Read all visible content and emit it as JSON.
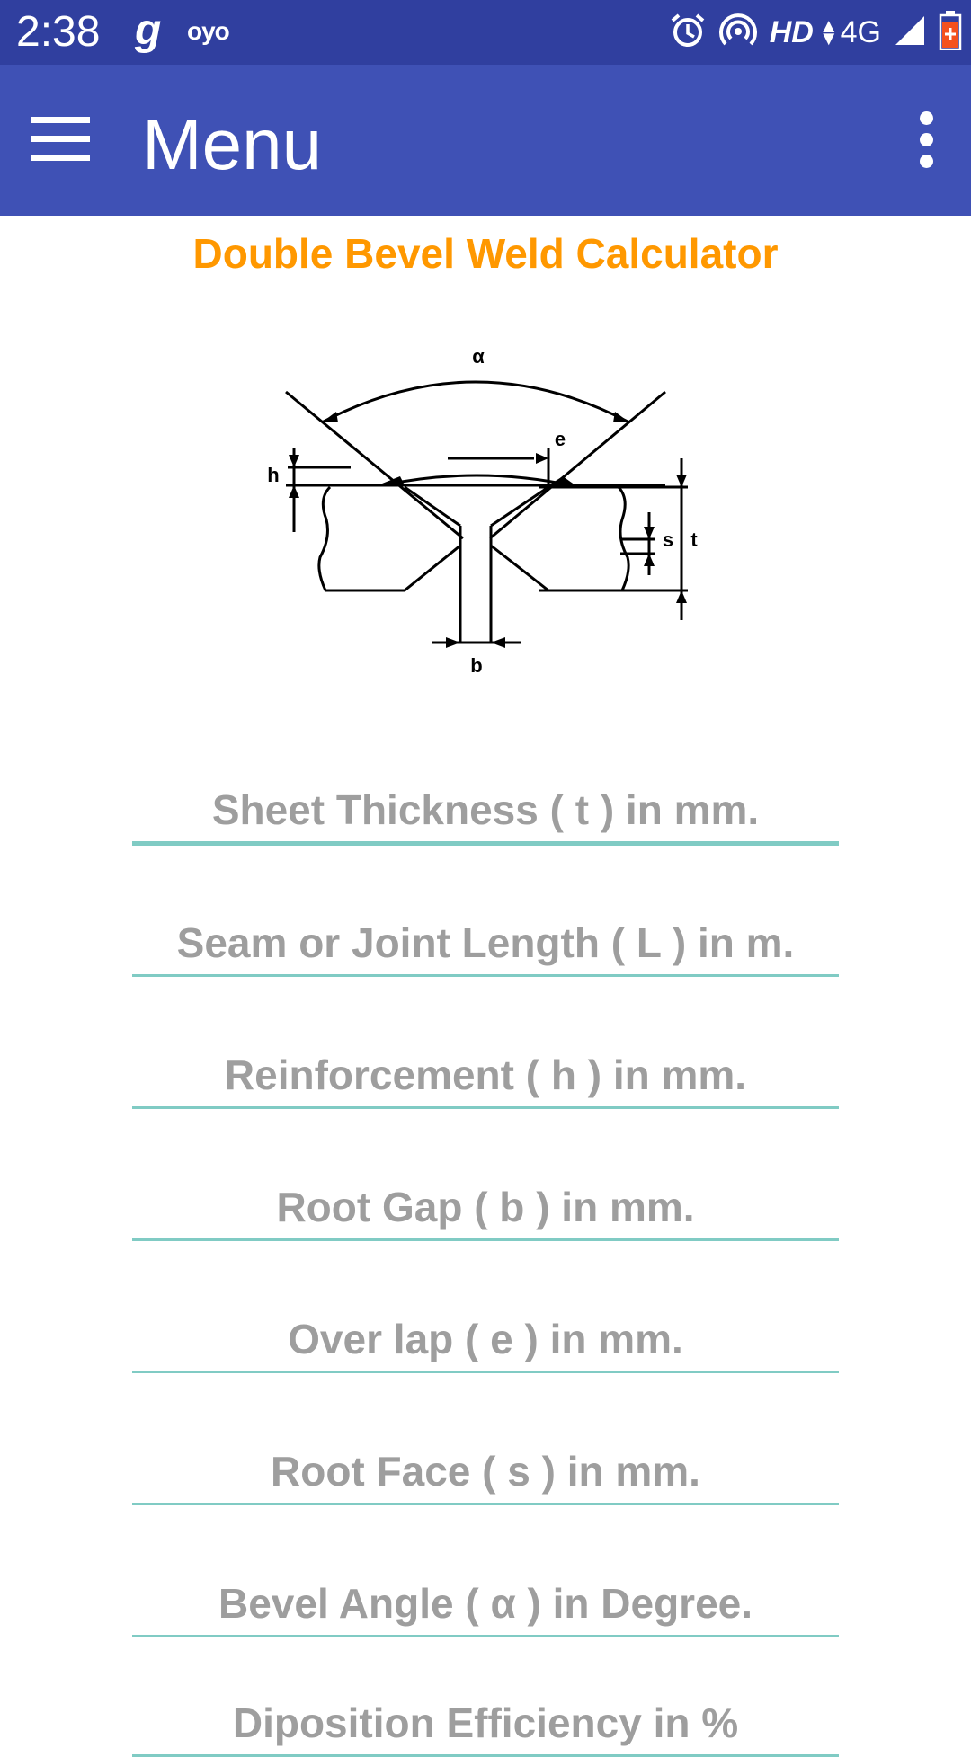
{
  "status_bar": {
    "time": "2:38",
    "left_glyph": "g",
    "oyo": "oyo",
    "hd": "HD",
    "network": "4G",
    "icons": [
      "alarm-icon",
      "hotspot-icon",
      "signal-icon",
      "battery-icon"
    ]
  },
  "app_bar": {
    "title": "Menu",
    "color": "#3F51B5",
    "status_color": "#303F9F"
  },
  "calculator": {
    "title": "Double Bevel Weld Calculator",
    "title_color": "#FF9800",
    "diagram_labels": {
      "alpha": "α",
      "e": "e",
      "h": "h",
      "s": "s",
      "t": "t",
      "b": "b"
    }
  },
  "fields": {
    "sheet_thickness": "Sheet Thickness ( t ) in mm.",
    "seam_length": "Seam or Joint Length ( L ) in m.",
    "reinforcement": "Reinforcement ( h ) in mm.",
    "root_gap": "Root Gap ( b ) in mm.",
    "overlap": "Over lap ( e ) in mm.",
    "root_face": "Root Face ( s ) in mm.",
    "bevel_angle": "Bevel Angle ( α ) in Degree.",
    "deposition_efficiency": "Diposition Efficiency in %"
  }
}
